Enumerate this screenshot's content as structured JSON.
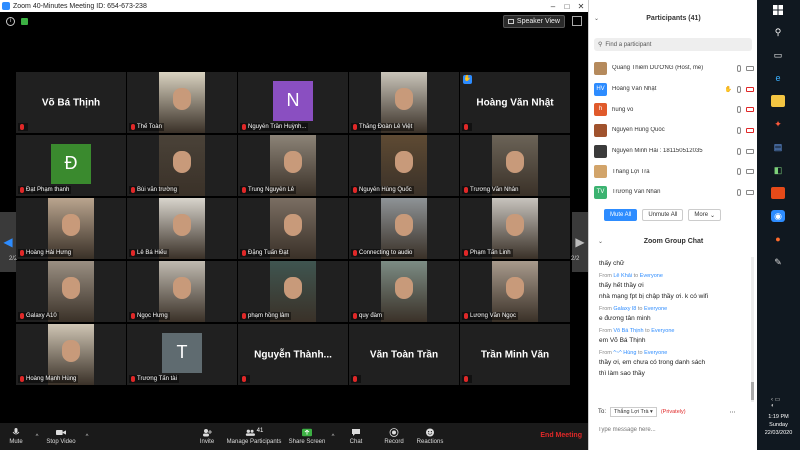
{
  "window": {
    "title": "Zoom 40-Minutes Meeting ID: 654-673-238"
  },
  "topbar": {
    "speaker_view_label": "Speaker View"
  },
  "grid": {
    "page_indicator": "2/2",
    "tiles": [
      {
        "name": "Võ Bá Thịnh",
        "kind": "name",
        "show_label": false
      },
      {
        "name": "Thế Toàn",
        "kind": "video",
        "bg": "#d9d2c0"
      },
      {
        "name": "Nguyễn Trần Huỳnh...",
        "kind": "avatar",
        "avatar_letter": "N",
        "avatar_color": "#8a4fc1"
      },
      {
        "name": "Thắng Đoàn Lê Việt",
        "kind": "video",
        "bg": "#c9c4b9"
      },
      {
        "name": "Hoàng Văn Nhật",
        "kind": "name",
        "show_label": false,
        "raised_hand": true
      },
      {
        "name": "Đạt Phạm thanh",
        "kind": "avatar",
        "avatar_letter": "Đ",
        "avatar_color": "#3a8a2e"
      },
      {
        "name": "Bùi văn trường",
        "kind": "video",
        "bg": "#4a4238"
      },
      {
        "name": "Trung Nguyễn Lê",
        "kind": "video",
        "bg": "#8c8377"
      },
      {
        "name": "Nguyễn Hùng Quốc",
        "kind": "video",
        "bg": "#5e4a33"
      },
      {
        "name": "Trương Văn Nhân",
        "kind": "video",
        "bg": "#6b6357"
      },
      {
        "name": "Hoàng Hải Hưng",
        "kind": "video",
        "bg": "#b9a48e"
      },
      {
        "name": "Lê Bá Hiếu",
        "kind": "video",
        "bg": "#d8d4cc"
      },
      {
        "name": "Đặng Tuấn Đạt",
        "kind": "video",
        "bg": "#7a6e62"
      },
      {
        "name": "Connecting to audio",
        "kind": "video",
        "bg": "#8e9396"
      },
      {
        "name": "Phạm Tấn Linh",
        "kind": "video",
        "bg": "#c7c3bd"
      },
      {
        "name": "Galaxy A10",
        "kind": "video",
        "bg": "#9a8f82"
      },
      {
        "name": "Ngọc Hưng",
        "kind": "video",
        "bg": "#c0bab0"
      },
      {
        "name": "phạm hồng lâm",
        "kind": "video",
        "bg": "#3f5550"
      },
      {
        "name": "quy đàm",
        "kind": "video",
        "bg": "#7c8c84"
      },
      {
        "name": "Lương Văn Ngọc",
        "kind": "video",
        "bg": "#a89a8c"
      },
      {
        "name": "Hoàng Mạnh Hùng",
        "kind": "video",
        "bg": "#cfc5b4"
      },
      {
        "name": "Trương Tấn tài",
        "kind": "avatar",
        "avatar_letter": "T",
        "avatar_color": "#5f6b70"
      },
      {
        "name": "Nguyễn Thành...",
        "kind": "name",
        "show_label": false
      },
      {
        "name": "Văn Toàn Trần",
        "kind": "name",
        "show_label": false
      },
      {
        "name": "Trần Minh Văn",
        "kind": "name",
        "show_label": false
      }
    ]
  },
  "toolbar": {
    "mute": "Mute",
    "stop_video": "Stop Video",
    "invite": "Invite",
    "manage_participants": "Manage Participants",
    "participant_count": "41",
    "share_screen": "Share Screen",
    "chat": "Chat",
    "record": "Record",
    "reactions": "Reactions",
    "end_meeting": "End Meeting"
  },
  "participants": {
    "title": "Participants (41)",
    "search_placeholder": "Find a participant",
    "list": [
      {
        "name": "Quang Thiêm DƯƠNG (Host, me)",
        "initials": "",
        "color": "#b58a5c",
        "mic": "on",
        "cam": "on"
      },
      {
        "name": "Hoàng Văn Nhật",
        "initials": "HV",
        "color": "#2d8cff",
        "mic": "on",
        "cam": "off",
        "hand": true
      },
      {
        "name": "hung vo",
        "initials": "h",
        "color": "#e05a2b",
        "mic": "on",
        "cam": "off"
      },
      {
        "name": "Nguyễn Hùng Quốc",
        "initials": "",
        "color": "#a0522d",
        "mic": "on",
        "cam": "off"
      },
      {
        "name": "Nguyễn Minh Hải : 181150512035",
        "initials": "",
        "color": "#3b3b3b",
        "mic": "on",
        "cam": "on"
      },
      {
        "name": "Thắng Lợi Trà",
        "initials": "",
        "color": "#d2a46a",
        "mic": "on",
        "cam": "on"
      },
      {
        "name": "Trương Văn Nhân",
        "initials": "TV",
        "color": "#3cb371",
        "mic": "on",
        "cam": "on"
      }
    ],
    "mute_all": "Mute All",
    "unmute_all": "Unmute All",
    "more": "More"
  },
  "chat": {
    "title": "Zoom Group Chat",
    "messages": [
      {
        "from": "",
        "to": "",
        "lines": [
          "thấy chữ"
        ]
      },
      {
        "from": "Lê Khải",
        "to": "Everyone",
        "lines": [
          "thấy hết thầy ơi",
          "nhà mạng fpt bị chập thầy ơi. k có wifi"
        ]
      },
      {
        "from": "Galaxy l8",
        "to": "Everyone",
        "lines": [
          "e đương tân minh"
        ]
      },
      {
        "from": "Võ Bá Thịnh",
        "to": "Everyone",
        "lines": [
          "em Võ Bá Thịnh"
        ]
      },
      {
        "from": "^~^ Hùng",
        "to": "Everyone",
        "lines": [
          "thầy ơi, em chưa có trong danh sách",
          "thì làm sao thầy"
        ]
      }
    ],
    "from_word": "From",
    "to_word": "to",
    "to_label": "To:",
    "recipient": "Thắng Lợi Trà",
    "privately": "(Privately)",
    "input_placeholder": "Type message here..."
  },
  "system": {
    "time": "1:19 PM",
    "day": "Sunday",
    "date": "22/03/2020"
  }
}
